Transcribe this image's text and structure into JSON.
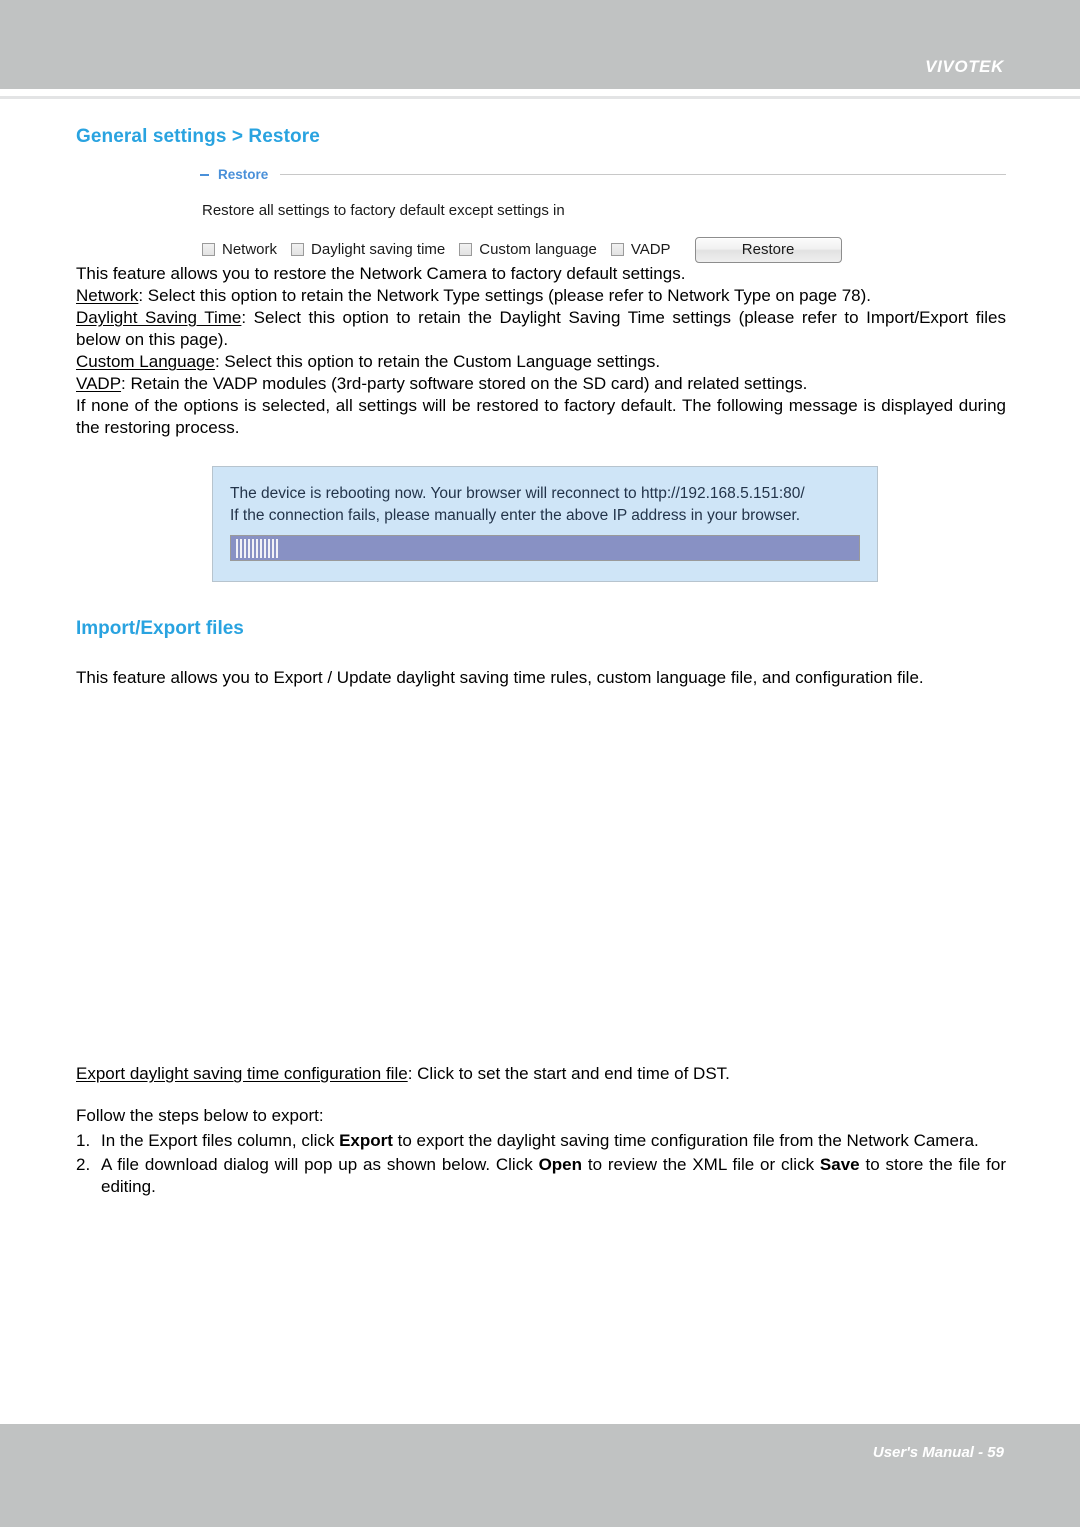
{
  "header": {
    "brand": "VIVOTEK"
  },
  "page": {
    "title": "General settings > Restore"
  },
  "restore_panel": {
    "legend": "Restore",
    "description": "Restore all settings to factory default except settings in",
    "checkboxes": [
      {
        "label": "Network",
        "checked": false
      },
      {
        "label": "Daylight saving time",
        "checked": false
      },
      {
        "label": "Custom language",
        "checked": false
      },
      {
        "label": "VADP",
        "checked": false
      }
    ],
    "button_label": "Restore"
  },
  "body": {
    "intro": "This feature allows you to restore the Network Camera to factory default settings.",
    "network_term": "Network",
    "network_rest": ": Select this option to retain the Network Type settings (please refer to Network Type on page 78).",
    "dst_term": "Daylight Saving Time",
    "dst_rest": ": Select this option to retain the Daylight Saving Time settings (please refer to Import/Export files below on this page).",
    "lang_term": "Custom Language",
    "lang_rest": ": Select this option to retain the Custom Language settings.",
    "vadp_term": "VADP",
    "vadp_rest": ": Retain the VADP modules (3rd-party software stored on the SD card) and related settings.",
    "none_selected": "If none of the options is selected, all settings will be restored to factory default.  The following message is displayed during the restoring process."
  },
  "reboot_dialog": {
    "line1": "The device is rebooting now. Your browser will reconnect to http://192.168.5.151:80/",
    "line2": "If the connection fails, please manually enter the above IP address in your browser.",
    "progress_label": "||||||||||"
  },
  "import_export": {
    "title": "Import/Export files",
    "description": "This feature allows you to Export / Update daylight saving time rules, custom language file, and configuration file.",
    "export_term": "Export daylight saving time configuration file",
    "export_rest": ": Click to set the start and end time of DST.",
    "follow_label": "Follow the steps below to export:",
    "steps": [
      {
        "num": "1.",
        "pre": "In the Export files column, click ",
        "bold1": "Export",
        "post": " to export the daylight saving time configuration file from the Network Camera."
      },
      {
        "num": "2.",
        "pre": "A file download dialog will pop up as shown below. Click ",
        "bold1": "Open",
        "mid": " to review the XML file or click ",
        "bold2": "Save",
        "post": " to store the file for editing."
      }
    ]
  },
  "footer": {
    "text": "User's Manual - 59"
  },
  "colors": {
    "header_gray": "#c0c2c2",
    "title_blue": "#29a3e0",
    "legend_blue": "#4a90d9",
    "dialog_bg": "#cfe5f7",
    "progress_bar": "#8891c4"
  }
}
